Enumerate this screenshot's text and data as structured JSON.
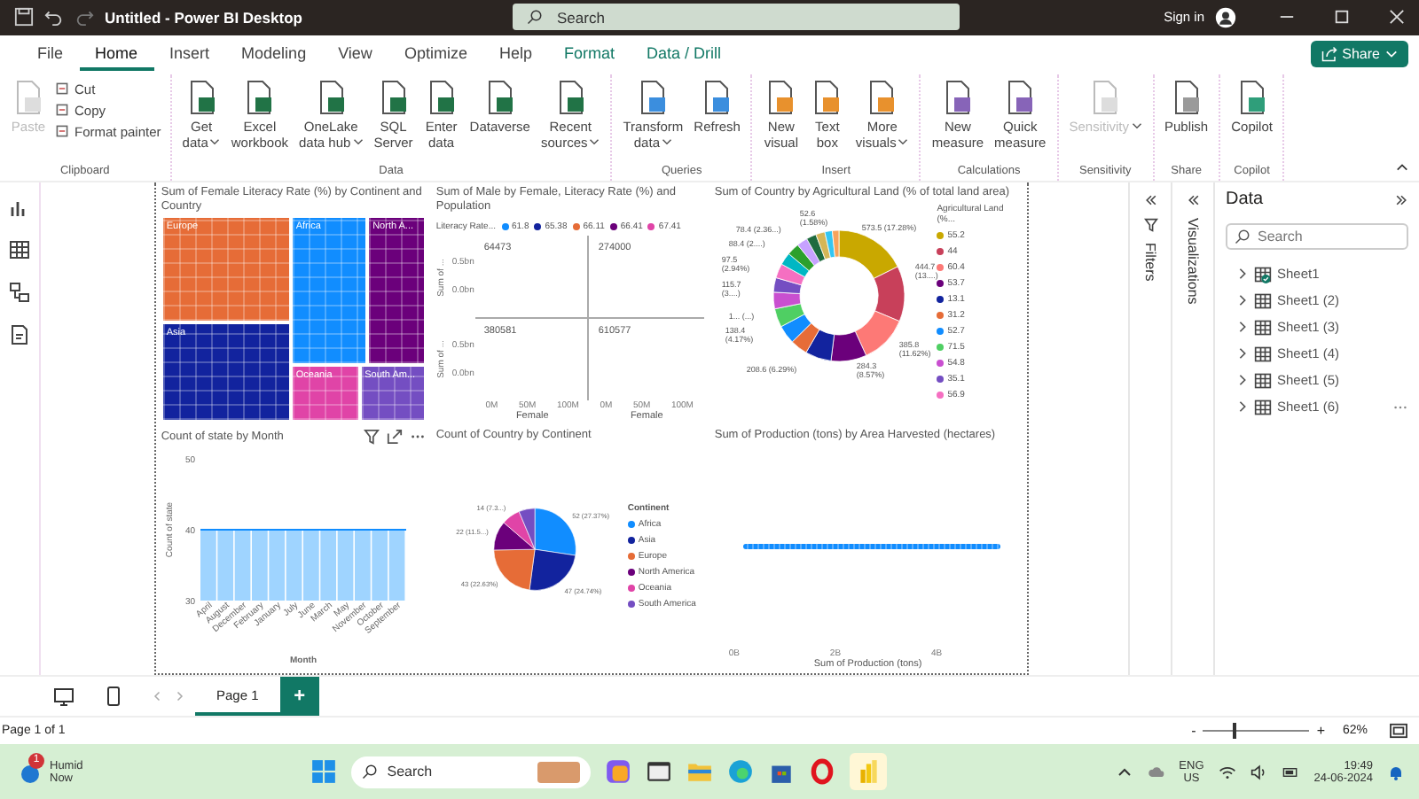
{
  "window": {
    "title": "Untitled - Power BI Desktop",
    "search_placeholder": "Search",
    "sign_in": "Sign in"
  },
  "menu": [
    {
      "label": "File",
      "selected": false,
      "contextual": false
    },
    {
      "label": "Home",
      "selected": true,
      "contextual": false
    },
    {
      "label": "Insert",
      "selected": false,
      "contextual": false
    },
    {
      "label": "Modeling",
      "selected": false,
      "contextual": false
    },
    {
      "label": "View",
      "selected": false,
      "contextual": false
    },
    {
      "label": "Optimize",
      "selected": false,
      "contextual": false
    },
    {
      "label": "Help",
      "selected": false,
      "contextual": false
    },
    {
      "label": "Format",
      "selected": false,
      "contextual": true
    },
    {
      "label": "Data / Drill",
      "selected": false,
      "contextual": true
    }
  ],
  "share_button": "Share",
  "ribbon": [
    {
      "label": "Clipboard",
      "buttons": [
        {
          "kind": "large",
          "label": "Paste",
          "disabled": true,
          "dropdown": false
        },
        {
          "kind": "small",
          "label": "Cut",
          "disabled": false,
          "dropdown": false
        },
        {
          "kind": "small",
          "label": "Copy",
          "disabled": false,
          "dropdown": false
        },
        {
          "kind": "small",
          "label": "Format painter",
          "disabled": false,
          "dropdown": false
        }
      ]
    },
    {
      "label": "Data",
      "buttons": [
        {
          "kind": "large",
          "label": "Get\ndata",
          "dropdown": true,
          "disabled": false
        },
        {
          "kind": "large",
          "label": "Excel\nworkbook",
          "dropdown": false,
          "disabled": false
        },
        {
          "kind": "large",
          "label": "OneLake\ndata hub",
          "dropdown": true,
          "disabled": false
        },
        {
          "kind": "large",
          "label": "SQL\nServer",
          "dropdown": false,
          "disabled": false
        },
        {
          "kind": "large",
          "label": "Enter\ndata",
          "dropdown": false,
          "disabled": false
        },
        {
          "kind": "large",
          "label": "Dataverse",
          "dropdown": false,
          "disabled": false
        },
        {
          "kind": "large",
          "label": "Recent\nsources",
          "dropdown": true,
          "disabled": false
        }
      ]
    },
    {
      "label": "Queries",
      "buttons": [
        {
          "kind": "large",
          "label": "Transform\ndata",
          "dropdown": true,
          "disabled": false
        },
        {
          "kind": "large",
          "label": "Refresh",
          "dropdown": false,
          "disabled": false
        }
      ]
    },
    {
      "label": "Insert",
      "buttons": [
        {
          "kind": "large",
          "label": "New\nvisual",
          "dropdown": false,
          "disabled": false
        },
        {
          "kind": "large",
          "label": "Text\nbox",
          "dropdown": false,
          "disabled": false
        },
        {
          "kind": "large",
          "label": "More\nvisuals",
          "dropdown": true,
          "disabled": false
        }
      ]
    },
    {
      "label": "Calculations",
      "buttons": [
        {
          "kind": "large",
          "label": "New\nmeasure",
          "dropdown": false,
          "disabled": false
        },
        {
          "kind": "large",
          "label": "Quick\nmeasure",
          "dropdown": false,
          "disabled": false
        }
      ]
    },
    {
      "label": "Sensitivity",
      "buttons": [
        {
          "kind": "large",
          "label": "Sensitivity",
          "dropdown": true,
          "disabled": true
        }
      ]
    },
    {
      "label": "Share",
      "buttons": [
        {
          "kind": "large",
          "label": "Publish",
          "dropdown": false,
          "disabled": false
        }
      ]
    },
    {
      "label": "Copilot",
      "buttons": [
        {
          "kind": "large",
          "label": "Copilot",
          "dropdown": false,
          "disabled": false
        }
      ]
    }
  ],
  "treemap": {
    "title": "Sum of Female Literacy Rate (%) by Continent and Country",
    "tiles": [
      {
        "label": "Europe",
        "color": "#e66c37"
      },
      {
        "label": "Africa",
        "color": "#118dff"
      },
      {
        "label": "North A...",
        "color": "#6b007b"
      },
      {
        "label": "Asia",
        "color": "#12239e"
      },
      {
        "label": "Oceania",
        "color": "#e044a7"
      },
      {
        "label": "South Am...",
        "color": "#744ec2"
      }
    ]
  },
  "small_multiples": {
    "title": "Sum of Male by Female, Literacy Rate (%) and Population",
    "legend_title": "Literacy Rate...",
    "legend": [
      {
        "label": "61.8",
        "color": "#118dff"
      },
      {
        "label": "65.38",
        "color": "#12239e"
      },
      {
        "label": "66.11",
        "color": "#e66c37"
      },
      {
        "label": "66.41",
        "color": "#6b007b"
      },
      {
        "label": "67.41",
        "color": "#e044a7"
      }
    ],
    "rows": [
      {
        "y_label": "Sum of ...",
        "y_ticks": [
          "0.5bn",
          "0.0bn"
        ],
        "panels": [
          "64473",
          "274000"
        ]
      },
      {
        "y_label": "Sum of ...",
        "y_ticks": [
          "0.5bn",
          "0.0bn"
        ],
        "panels": [
          "380581",
          "610577"
        ]
      }
    ],
    "columns": [
      {
        "x_ticks": [
          "0M",
          "50M",
          "100M"
        ],
        "x_label": "Female"
      },
      {
        "x_ticks": [
          "0M",
          "50M",
          "100M"
        ],
        "x_label": "Female"
      }
    ]
  },
  "donut": {
    "title": "Sum of Country by Agricultural Land (% of total land area)",
    "legend_title": "Agricultural Land (%...",
    "legend": [
      {
        "label": "55.2",
        "color": "#c9a800"
      },
      {
        "label": "44",
        "color": "#c8405a"
      },
      {
        "label": "60.4",
        "color": "#fd7976"
      },
      {
        "label": "53.7",
        "color": "#6b007b"
      },
      {
        "label": "13.1",
        "color": "#12239e"
      },
      {
        "label": "31.2",
        "color": "#e66c37"
      },
      {
        "label": "52.7",
        "color": "#118dff"
      },
      {
        "label": "71.5",
        "color": "#4fcf63"
      },
      {
        "label": "54.8",
        "color": "#c94fd0"
      },
      {
        "label": "35.1",
        "color": "#744ec2"
      },
      {
        "label": "56.9",
        "color": "#f56fc1"
      }
    ],
    "data_labels": [
      "52.6\n(1.58%)",
      "78.4 (2.36...)",
      "573.5 (17.28%)",
      "88.4 (2....)",
      "97.5\n(2.94%)",
      "444.7\n(13....)",
      "115.7\n(3....)",
      "1... (...)",
      "138.4\n(4.17%)",
      "385.8\n(11.62%)",
      "208.6 (6.29%)",
      "284.3\n(8.57%)"
    ]
  },
  "bar_visual": {
    "chart_data": {
      "type": "bar",
      "title": "Count of state by Month",
      "xlabel": "Month",
      "ylabel": "Count of state",
      "categories": [
        "April",
        "August",
        "December",
        "February",
        "January",
        "July",
        "June",
        "March",
        "May",
        "November",
        "October",
        "September"
      ],
      "values": [
        40,
        40,
        40,
        40,
        40,
        40,
        40,
        40,
        40,
        40,
        40,
        40
      ],
      "ylim": [
        30,
        50
      ],
      "yticks": [
        30,
        40,
        50
      ]
    }
  },
  "pie_visual": {
    "chart_data": {
      "type": "pie",
      "title": "Count of Country by Continent",
      "categories": [
        "Africa",
        "Asia",
        "Europe",
        "North America",
        "Oceania",
        "South America"
      ],
      "values": [
        52,
        47,
        43,
        22,
        14,
        12
      ],
      "value_labels": [
        "52 (27.37%)",
        "47 (24.74%)",
        "43 (22.63%)",
        "22 (11.5...)",
        "14 (7.3...)",
        null
      ]
    },
    "legend_title": "Continent",
    "legend": [
      {
        "color": "#118dff"
      },
      {
        "color": "#12239e"
      },
      {
        "color": "#e66c37"
      },
      {
        "color": "#6b007b"
      },
      {
        "color": "#e044a7"
      },
      {
        "color": "#744ec2"
      }
    ]
  },
  "scatter": {
    "title": "Sum of Production (tons) by Area Harvested (hectares)",
    "x_ticks": [
      "0B",
      "2B",
      "4B"
    ],
    "x_label": "Sum of Production (tons)"
  },
  "filters_pane": "Filters",
  "visualizations_pane": "Visualizations",
  "data_pane": {
    "title": "Data",
    "search_placeholder": "Search",
    "tables": [
      {
        "label": "Sheet1",
        "checked": true
      },
      {
        "label": "Sheet1 (2)",
        "checked": false
      },
      {
        "label": "Sheet1 (3)",
        "checked": false
      },
      {
        "label": "Sheet1 (4)",
        "checked": false
      },
      {
        "label": "Sheet1 (5)",
        "checked": false
      },
      {
        "label": "Sheet1 (6)",
        "checked": false
      }
    ]
  },
  "pages": [
    {
      "label": "Page 1",
      "selected": true
    }
  ],
  "add_page": "+",
  "status": {
    "page": "Page 1 of 1",
    "zoom_out": "-",
    "zoom_in": "+",
    "level": 0.28,
    "zoom": "62%"
  },
  "taskbar": {
    "weather": "Humid",
    "weather_time": "Now",
    "badge": "1",
    "search_placeholder": "Search",
    "lang": "ENG",
    "region": "US",
    "time": "19:49",
    "date": "24-06-2024"
  }
}
